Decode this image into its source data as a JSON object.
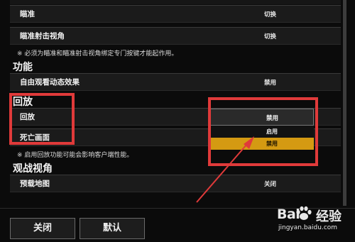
{
  "rows": [
    {
      "label": "瞄准",
      "value": "切换"
    },
    {
      "label": "瞄准射击视角",
      "value": "切换"
    },
    {
      "label": "自由观看动态效果",
      "value": "禁用"
    },
    {
      "label": "回放"
    },
    {
      "label": "死亡画面"
    },
    {
      "label": "预载地图",
      "value": "关闭"
    }
  ],
  "notes": {
    "aim_bind": "※ 必须为瞄准和瞄准射击视角绑定专门按键才能起作用。",
    "replay_perf": "※ 启用回放功能可能会影响客户端性能。"
  },
  "sections": {
    "function": "功能",
    "replay": "回放",
    "spectate": "观战视角"
  },
  "dropdown": {
    "selected": "禁用",
    "options": [
      "启用",
      "禁用"
    ]
  },
  "buttons": {
    "close": "关闭",
    "default": "默认"
  },
  "watermark": {
    "brand_left": "Bai",
    "brand_right": "经验",
    "url": "jingyan.baidu.com"
  },
  "colors": {
    "accent": "#d49a12",
    "annotation": "#e03a3a"
  }
}
